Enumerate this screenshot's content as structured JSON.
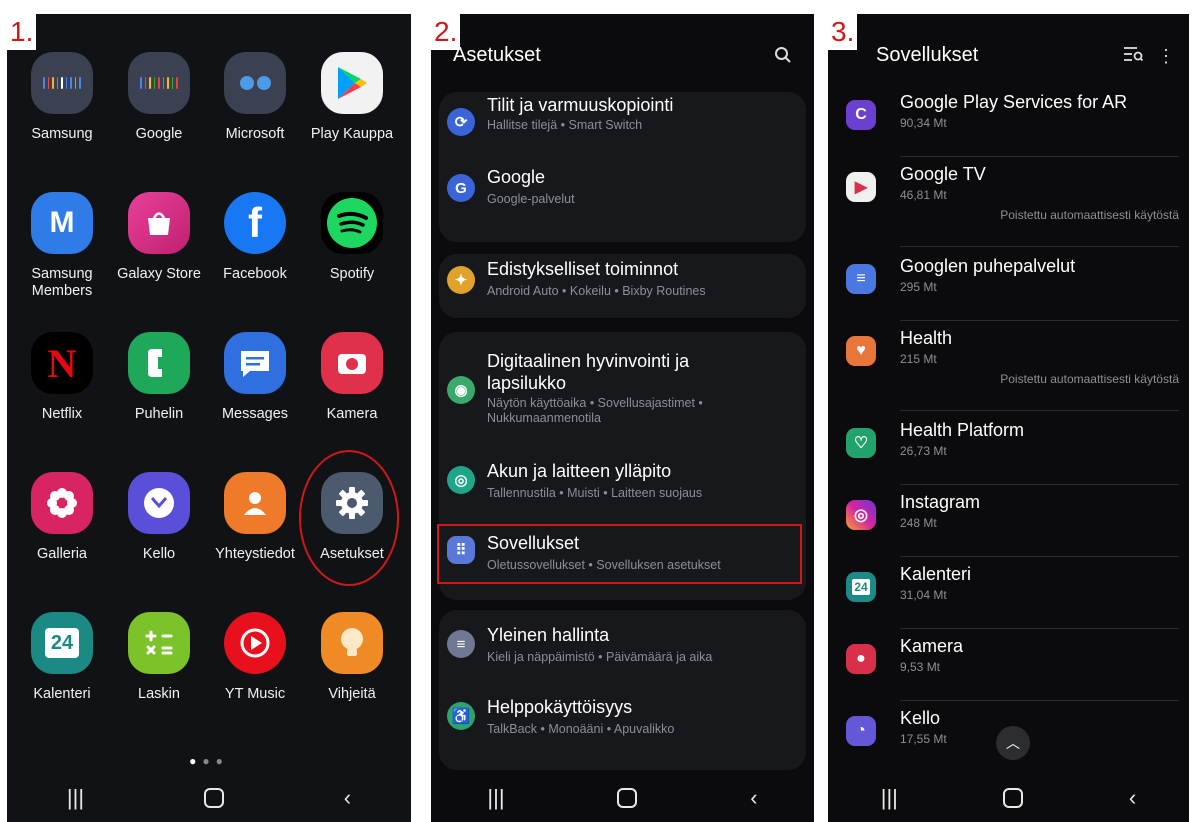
{
  "panel1": {
    "step": "1.",
    "apps": [
      {
        "label": "Samsung",
        "icon": "samsung-folder-icon"
      },
      {
        "label": "Google",
        "icon": "google-folder-icon"
      },
      {
        "label": "Microsoft",
        "icon": "microsoft-folder-icon"
      },
      {
        "label": "Play Kauppa",
        "icon": "play-store-icon"
      },
      {
        "label": "Samsung Members",
        "icon": "samsung-members-icon"
      },
      {
        "label": "Galaxy Store",
        "icon": "galaxy-store-icon"
      },
      {
        "label": "Facebook",
        "icon": "facebook-icon"
      },
      {
        "label": "Spotify",
        "icon": "spotify-icon"
      },
      {
        "label": "Netflix",
        "icon": "netflix-icon"
      },
      {
        "label": "Puhelin",
        "icon": "phone-icon"
      },
      {
        "label": "Messages",
        "icon": "messages-icon"
      },
      {
        "label": "Kamera",
        "icon": "camera-icon"
      },
      {
        "label": "Galleria",
        "icon": "gallery-icon"
      },
      {
        "label": "Kello",
        "icon": "clock-icon"
      },
      {
        "label": "Yhteystiedot",
        "icon": "contacts-icon"
      },
      {
        "label": "Asetukset",
        "icon": "settings-gear-icon"
      },
      {
        "label": "Kalenteri",
        "icon": "calendar-icon"
      },
      {
        "label": "Laskin",
        "icon": "calculator-icon"
      },
      {
        "label": "YT Music",
        "icon": "yt-music-icon"
      },
      {
        "label": "Vihjeitä",
        "icon": "tips-bulb-icon"
      }
    ],
    "calendar_day": "24"
  },
  "panel2": {
    "step": "2.",
    "title": "Asetukset",
    "items": [
      {
        "title": "Tilit ja varmuuskopiointi",
        "sub": "Hallitse tilejä  •  Smart Switch",
        "icon": "backup-sync-icon",
        "color": "#3b64d9"
      },
      {
        "title": "Google",
        "sub": "Google-palvelut",
        "icon": "google-g-icon",
        "color": "#3b64d9"
      },
      {
        "title": "Edistykselliset toiminnot",
        "sub": "Android Auto  •  Kokeilu  •  Bixby Routines",
        "icon": "advanced-features-icon",
        "color": "#e0a22a"
      },
      {
        "title": "Digitaalinen hyvinvointi ja lapsilukko",
        "sub": "Näytön käyttöaika  •  Sovellusajastimet  •  Nukkumaanmenotila",
        "icon": "wellbeing-icon",
        "color": "#3aa96b"
      },
      {
        "title": "Akun ja laitteen ylläpito",
        "sub": "Tallennustila  •  Muisti  •  Laitteen suojaus",
        "icon": "device-care-icon",
        "color": "#1fa58a"
      },
      {
        "title": "Sovellukset",
        "sub": "Oletussovellukset  •  Sovelluksen asetukset",
        "icon": "apps-grid-icon",
        "color": "#5a78d8"
      },
      {
        "title": "Yleinen hallinta",
        "sub": "Kieli ja näppäimistö  •  Päivämäärä ja aika",
        "icon": "general-management-icon",
        "color": "#6f7890"
      },
      {
        "title": "Helppokäyttöisyys",
        "sub": "TalkBack  •  Monoääni  •  Apuvalikko",
        "icon": "accessibility-icon",
        "color": "#2ea36c"
      }
    ]
  },
  "panel3": {
    "step": "3.",
    "title": "Sovellukset",
    "apps": [
      {
        "name": "Google Play Services for AR",
        "size": "90,34 Mt",
        "note": "",
        "icon": "arcore-icon",
        "color": "#6b3fd0"
      },
      {
        "name": "Google TV",
        "size": "46,81 Mt",
        "note": "Poistettu automaattisesti käytöstä",
        "icon": "google-tv-icon",
        "color": "#e8e8e8"
      },
      {
        "name": "Googlen puhepalvelut",
        "size": "295 Mt",
        "note": "",
        "icon": "speech-services-icon",
        "color": "#4a78e0"
      },
      {
        "name": "Health",
        "size": "215 Mt",
        "note": "Poistettu automaattisesti käytöstä",
        "icon": "health-heart-icon",
        "color": "#e8763a"
      },
      {
        "name": "Health Platform",
        "size": "26,73 Mt",
        "note": "",
        "icon": "health-platform-icon",
        "color": "#21a36b"
      },
      {
        "name": "Instagram",
        "size": "248 Mt",
        "note": "",
        "icon": "instagram-icon",
        "color": "#c2338a"
      },
      {
        "name": "Kalenteri",
        "size": "31,04 Mt",
        "note": "",
        "icon": "calendar-icon",
        "color": "#1c8a86"
      },
      {
        "name": "Kamera",
        "size": "9,53 Mt",
        "note": "",
        "icon": "camera-icon",
        "color": "#d8304a"
      },
      {
        "name": "Kello",
        "size": "17,55 Mt",
        "note": "",
        "icon": "clock-icon",
        "color": "#6458d8"
      }
    ],
    "calendar_day": "24"
  }
}
